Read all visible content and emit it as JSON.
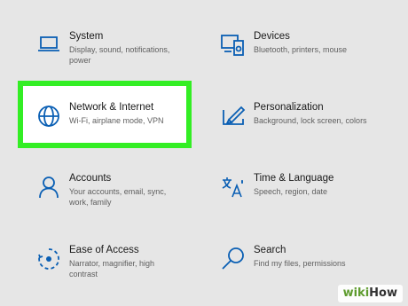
{
  "settings": {
    "system": {
      "title": "System",
      "desc": "Display, sound, notifications, power",
      "icon": "laptop-icon"
    },
    "devices": {
      "title": "Devices",
      "desc": "Bluetooth, printers, mouse",
      "icon": "devices-icon"
    },
    "network": {
      "title": "Network & Internet",
      "desc": "Wi-Fi, airplane mode, VPN",
      "icon": "globe-icon"
    },
    "personalization": {
      "title": "Personalization",
      "desc": "Background, lock screen, colors",
      "icon": "paint-brush-icon"
    },
    "accounts": {
      "title": "Accounts",
      "desc": "Your accounts, email, sync, work, family",
      "icon": "person-icon"
    },
    "time_language": {
      "title": "Time & Language",
      "desc": "Speech, region, date",
      "icon": "language-icon"
    },
    "ease_of_access": {
      "title": "Ease of Access",
      "desc": "Narrator, magnifier, high contrast",
      "icon": "ease-of-access-icon"
    },
    "search": {
      "title": "Search",
      "desc": "Find my files, permissions",
      "icon": "search-icon"
    }
  },
  "watermark": {
    "prefix": "wiki",
    "suffix": "How"
  },
  "colors": {
    "accent": "#0a5fb4",
    "highlight_border": "#33ee24",
    "background": "#e6e6e6"
  }
}
